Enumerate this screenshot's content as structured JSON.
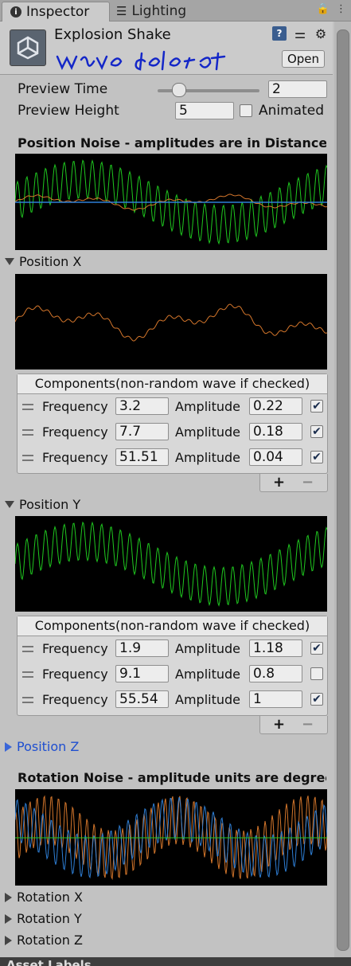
{
  "tabs": [
    {
      "label": "Inspector",
      "icon": "info-icon"
    },
    {
      "label": "Lighting",
      "icon": "lighting-icon"
    }
  ],
  "header": {
    "title": "Explosion Shake",
    "annotation": "wave delete",
    "open_label": "Open"
  },
  "preview": {
    "time_label": "Preview Time",
    "time_value": "2",
    "time_slider_fraction": 0.2,
    "height_label": "Preview Height",
    "height_value": "5",
    "animated_label": "Animated",
    "animated_checked": false
  },
  "position_noise": {
    "title": "Position Noise - amplitudes are in Distance units",
    "x": {
      "label": "Position X",
      "components_title": "Components(non-random wave if checked)",
      "rows": [
        {
          "freq_label": "Frequency",
          "freq": "3.2",
          "amp_label": "Amplitude",
          "amp": "0.22",
          "checked": true
        },
        {
          "freq_label": "Frequency",
          "freq": "7.7",
          "amp_label": "Amplitude",
          "amp": "0.18",
          "checked": true
        },
        {
          "freq_label": "Frequency",
          "freq": "51.51",
          "amp_label": "Amplitude",
          "amp": "0.04",
          "checked": true
        }
      ]
    },
    "y": {
      "label": "Position Y",
      "components_title": "Components(non-random wave if checked)",
      "rows": [
        {
          "freq_label": "Frequency",
          "freq": "1.9",
          "amp_label": "Amplitude",
          "amp": "1.18",
          "checked": true
        },
        {
          "freq_label": "Frequency",
          "freq": "9.1",
          "amp_label": "Amplitude",
          "amp": "0.8",
          "checked": false
        },
        {
          "freq_label": "Frequency",
          "freq": "55.54",
          "amp_label": "Amplitude",
          "amp": "1",
          "checked": true
        }
      ]
    },
    "z": {
      "label": "Position Z"
    }
  },
  "rotation_noise": {
    "title": "Rotation Noise - amplitude units are degrees",
    "x_label": "Rotation X",
    "y_label": "Rotation Y",
    "z_label": "Rotation Z"
  },
  "footer": "Asset Labels",
  "colors": {
    "green": "#1fc81f",
    "orange": "#d4762b",
    "blue": "#2e7fd6",
    "bg": "#c2c2c2"
  }
}
